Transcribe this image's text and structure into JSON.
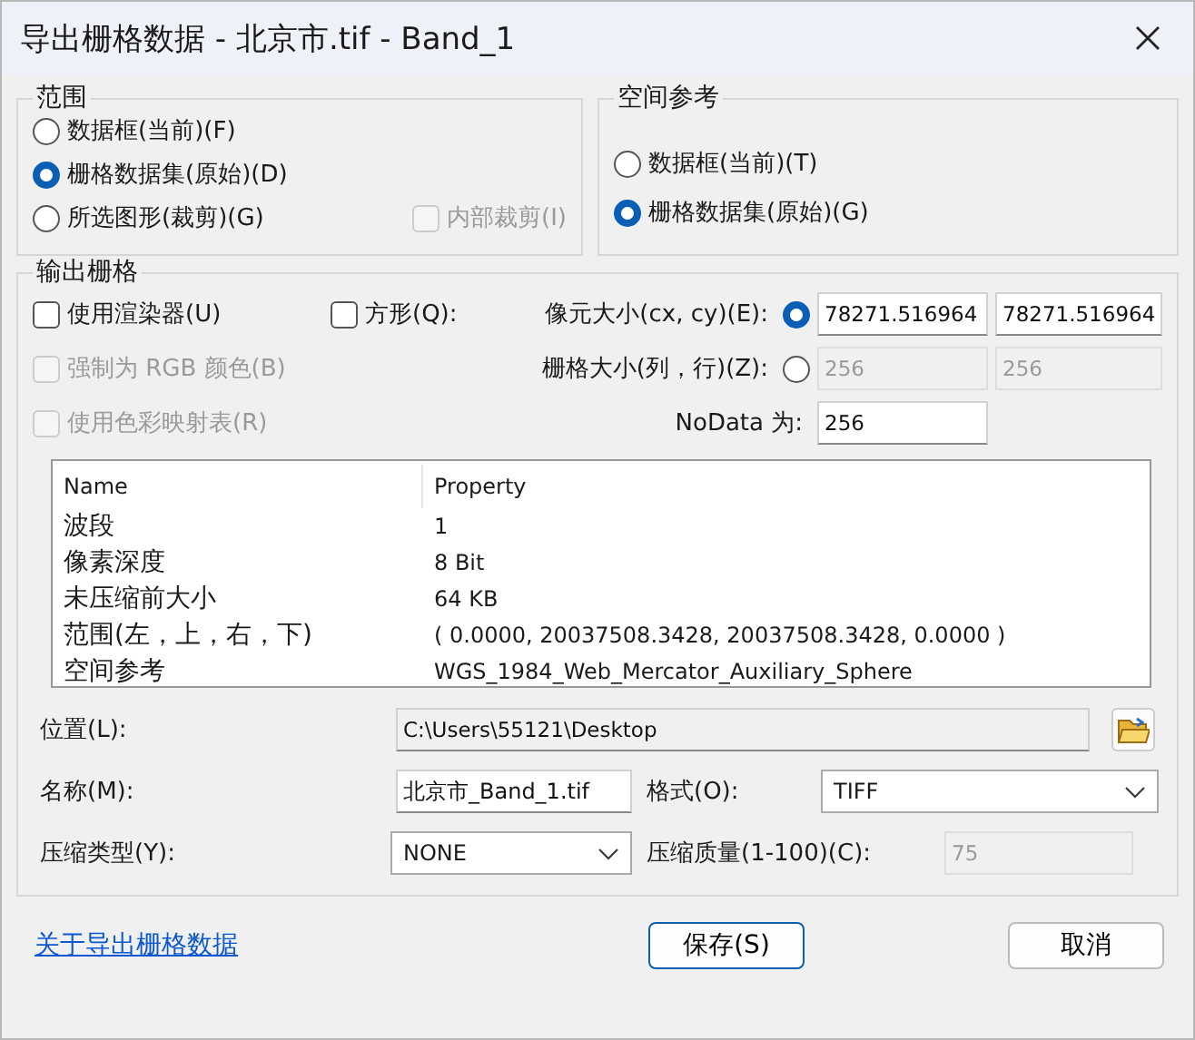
{
  "window": {
    "title": "导出栅格数据 - 北京市.tif - Band_1"
  },
  "extent": {
    "title": "范围",
    "options": [
      {
        "label": "数据框(当前)(F)",
        "selected": false
      },
      {
        "label": "栅格数据集(原始)(D)",
        "selected": true
      },
      {
        "label": "所选图形(裁剪)(G)",
        "selected": false
      }
    ],
    "inner_clip": {
      "label": "内部裁剪(I)",
      "checked": false,
      "disabled": true
    }
  },
  "spatial_reference": {
    "title": "空间参考",
    "options": [
      {
        "label": "数据框(当前)(T)",
        "selected": false
      },
      {
        "label": "栅格数据集(原始)(G)",
        "selected": true
      }
    ]
  },
  "output": {
    "title": "输出栅格",
    "checkboxes": [
      {
        "label": "使用渲染器(U)",
        "checked": false,
        "disabled": false
      },
      {
        "label": "强制为 RGB 颜色(B)",
        "checked": false,
        "disabled": true
      },
      {
        "label": "使用色彩映射表(R)",
        "checked": false,
        "disabled": true
      }
    ],
    "square": {
      "label": "方形(Q):",
      "checked": false
    },
    "size_options": [
      {
        "label": "像元大小(cx, cy)(E):",
        "selected": true,
        "values": [
          "78271.516964",
          "78271.516964"
        ]
      },
      {
        "label": "栅格大小(列，行)(Z):",
        "selected": false,
        "values": [
          "256",
          "256"
        ]
      }
    ],
    "nodata": {
      "label": "NoData 为:",
      "value": "256"
    },
    "properties": {
      "columns": [
        "Name",
        "Property"
      ],
      "rows": [
        [
          "波段",
          "1"
        ],
        [
          "像素深度",
          "8 Bit"
        ],
        [
          "未压缩前大小",
          "64 KB"
        ],
        [
          "范围(左，上，右，下)",
          "( 0.0000, 20037508.3428, 20037508.3428, 0.0000 )"
        ],
        [
          "空间参考",
          "WGS_1984_Web_Mercator_Auxiliary_Sphere"
        ]
      ]
    },
    "location": {
      "label": "位置(L):",
      "value": "C:\\Users\\55121\\Desktop"
    },
    "name": {
      "label": "名称(M):",
      "value": "北京市_Band_1.tif"
    },
    "format": {
      "label": "格式(O):",
      "value": "TIFF"
    },
    "compression_type": {
      "label": "压缩类型(Y):",
      "value": "NONE"
    },
    "compression_quality": {
      "label": "压缩质量(1-100)(C):",
      "value": "75",
      "disabled": true
    }
  },
  "footer": {
    "help_link": "关于导出栅格数据",
    "buttons": [
      {
        "label": "保存(S)",
        "default": true
      },
      {
        "label": "取消",
        "default": false
      }
    ]
  }
}
